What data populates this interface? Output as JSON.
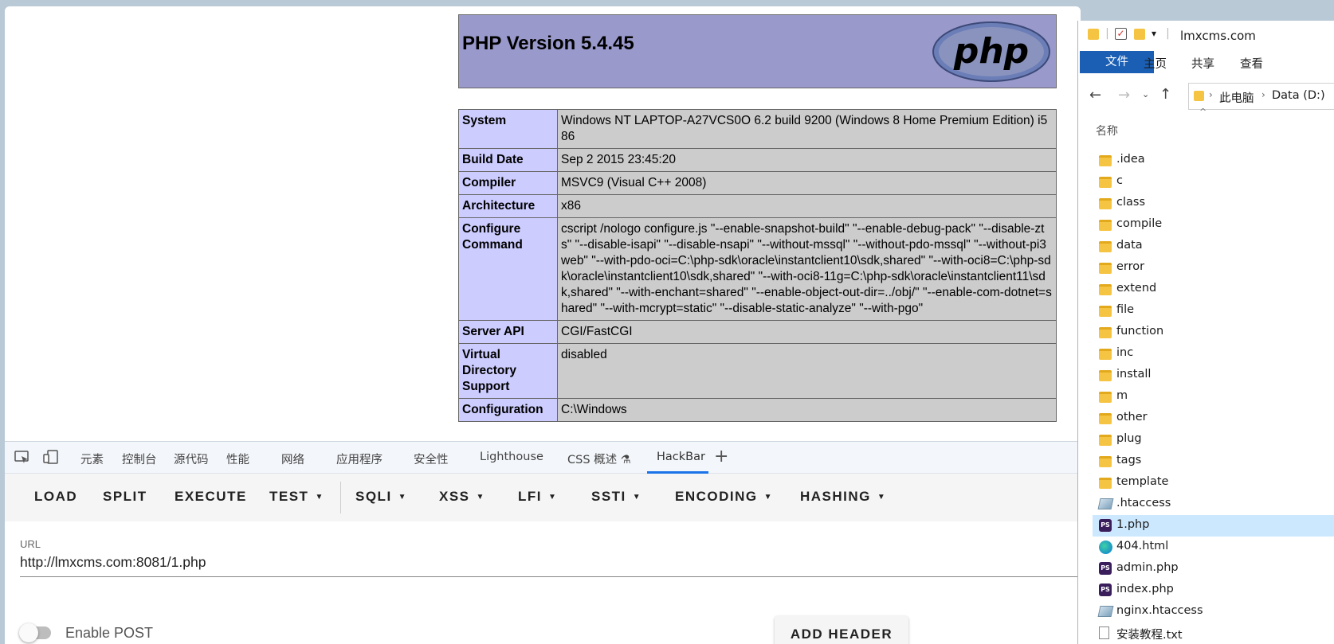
{
  "phpinfo": {
    "version_title": "PHP Version 5.4.45",
    "logo_text": "php",
    "rows": [
      {
        "key": "System",
        "value": "Windows NT LAPTOP-A27VCS0O 6.2 build 9200 (Windows 8 Home Premium Edition) i586"
      },
      {
        "key": "Build Date",
        "value": "Sep 2 2015 23:45:20"
      },
      {
        "key": "Compiler",
        "value": "MSVC9 (Visual C++ 2008)"
      },
      {
        "key": "Architecture",
        "value": "x86"
      },
      {
        "key": "Configure Command",
        "value": "cscript /nologo configure.js \"--enable-snapshot-build\" \"--enable-debug-pack\" \"--disable-zts\" \"--disable-isapi\" \"--disable-nsapi\" \"--without-mssql\" \"--without-pdo-mssql\" \"--without-pi3web\" \"--with-pdo-oci=C:\\php-sdk\\oracle\\instantclient10\\sdk,shared\" \"--with-oci8=C:\\php-sdk\\oracle\\instantclient10\\sdk,shared\" \"--with-oci8-11g=C:\\php-sdk\\oracle\\instantclient11\\sdk,shared\" \"--with-enchant=shared\" \"--enable-object-out-dir=../obj/\" \"--enable-com-dotnet=shared\" \"--with-mcrypt=static\" \"--disable-static-analyze\" \"--with-pgo\""
      },
      {
        "key": "Server API",
        "value": "CGI/FastCGI"
      },
      {
        "key": "Virtual Directory Support",
        "value": "disabled"
      },
      {
        "key": "Configuration",
        "value": "C:\\Windows"
      }
    ]
  },
  "devtools": {
    "tabs": [
      "元素",
      "控制台",
      "源代码",
      "性能",
      "网络",
      "应用程序",
      "安全性",
      "Lighthouse",
      "CSS 概述",
      "HackBar"
    ],
    "hackbar": {
      "buttons": [
        "LOAD",
        "SPLIT",
        "EXECUTE",
        "TEST",
        "SQLI",
        "XSS",
        "LFI",
        "SSTI",
        "ENCODING",
        "HASHING"
      ],
      "url_label": "URL",
      "url_value": "http://lmxcms.com:8081/1.php",
      "post_label": "Enable POST",
      "add_header_label": "ADD HEADER"
    }
  },
  "explorer": {
    "title": "lmxcms.com",
    "ribbon": [
      "文件",
      "主页",
      "共享",
      "查看"
    ],
    "address": [
      "此电脑",
      "Data (D:)"
    ],
    "column_header": "名称",
    "items": [
      {
        "name": ".idea",
        "type": "folder"
      },
      {
        "name": "c",
        "type": "folder"
      },
      {
        "name": "class",
        "type": "folder"
      },
      {
        "name": "compile",
        "type": "folder"
      },
      {
        "name": "data",
        "type": "folder"
      },
      {
        "name": "error",
        "type": "folder"
      },
      {
        "name": "extend",
        "type": "folder"
      },
      {
        "name": "file",
        "type": "folder"
      },
      {
        "name": "function",
        "type": "folder"
      },
      {
        "name": "inc",
        "type": "folder"
      },
      {
        "name": "install",
        "type": "folder"
      },
      {
        "name": "m",
        "type": "folder"
      },
      {
        "name": "other",
        "type": "folder"
      },
      {
        "name": "plug",
        "type": "folder"
      },
      {
        "name": "tags",
        "type": "folder"
      },
      {
        "name": "template",
        "type": "folder"
      },
      {
        "name": ".htaccess",
        "type": "file"
      },
      {
        "name": "1.php",
        "type": "php",
        "selected": true
      },
      {
        "name": "404.html",
        "type": "edge"
      },
      {
        "name": "admin.php",
        "type": "php"
      },
      {
        "name": "index.php",
        "type": "php"
      },
      {
        "name": "nginx.htaccess",
        "type": "file"
      },
      {
        "name": "安装教程.txt",
        "type": "txt"
      }
    ]
  }
}
